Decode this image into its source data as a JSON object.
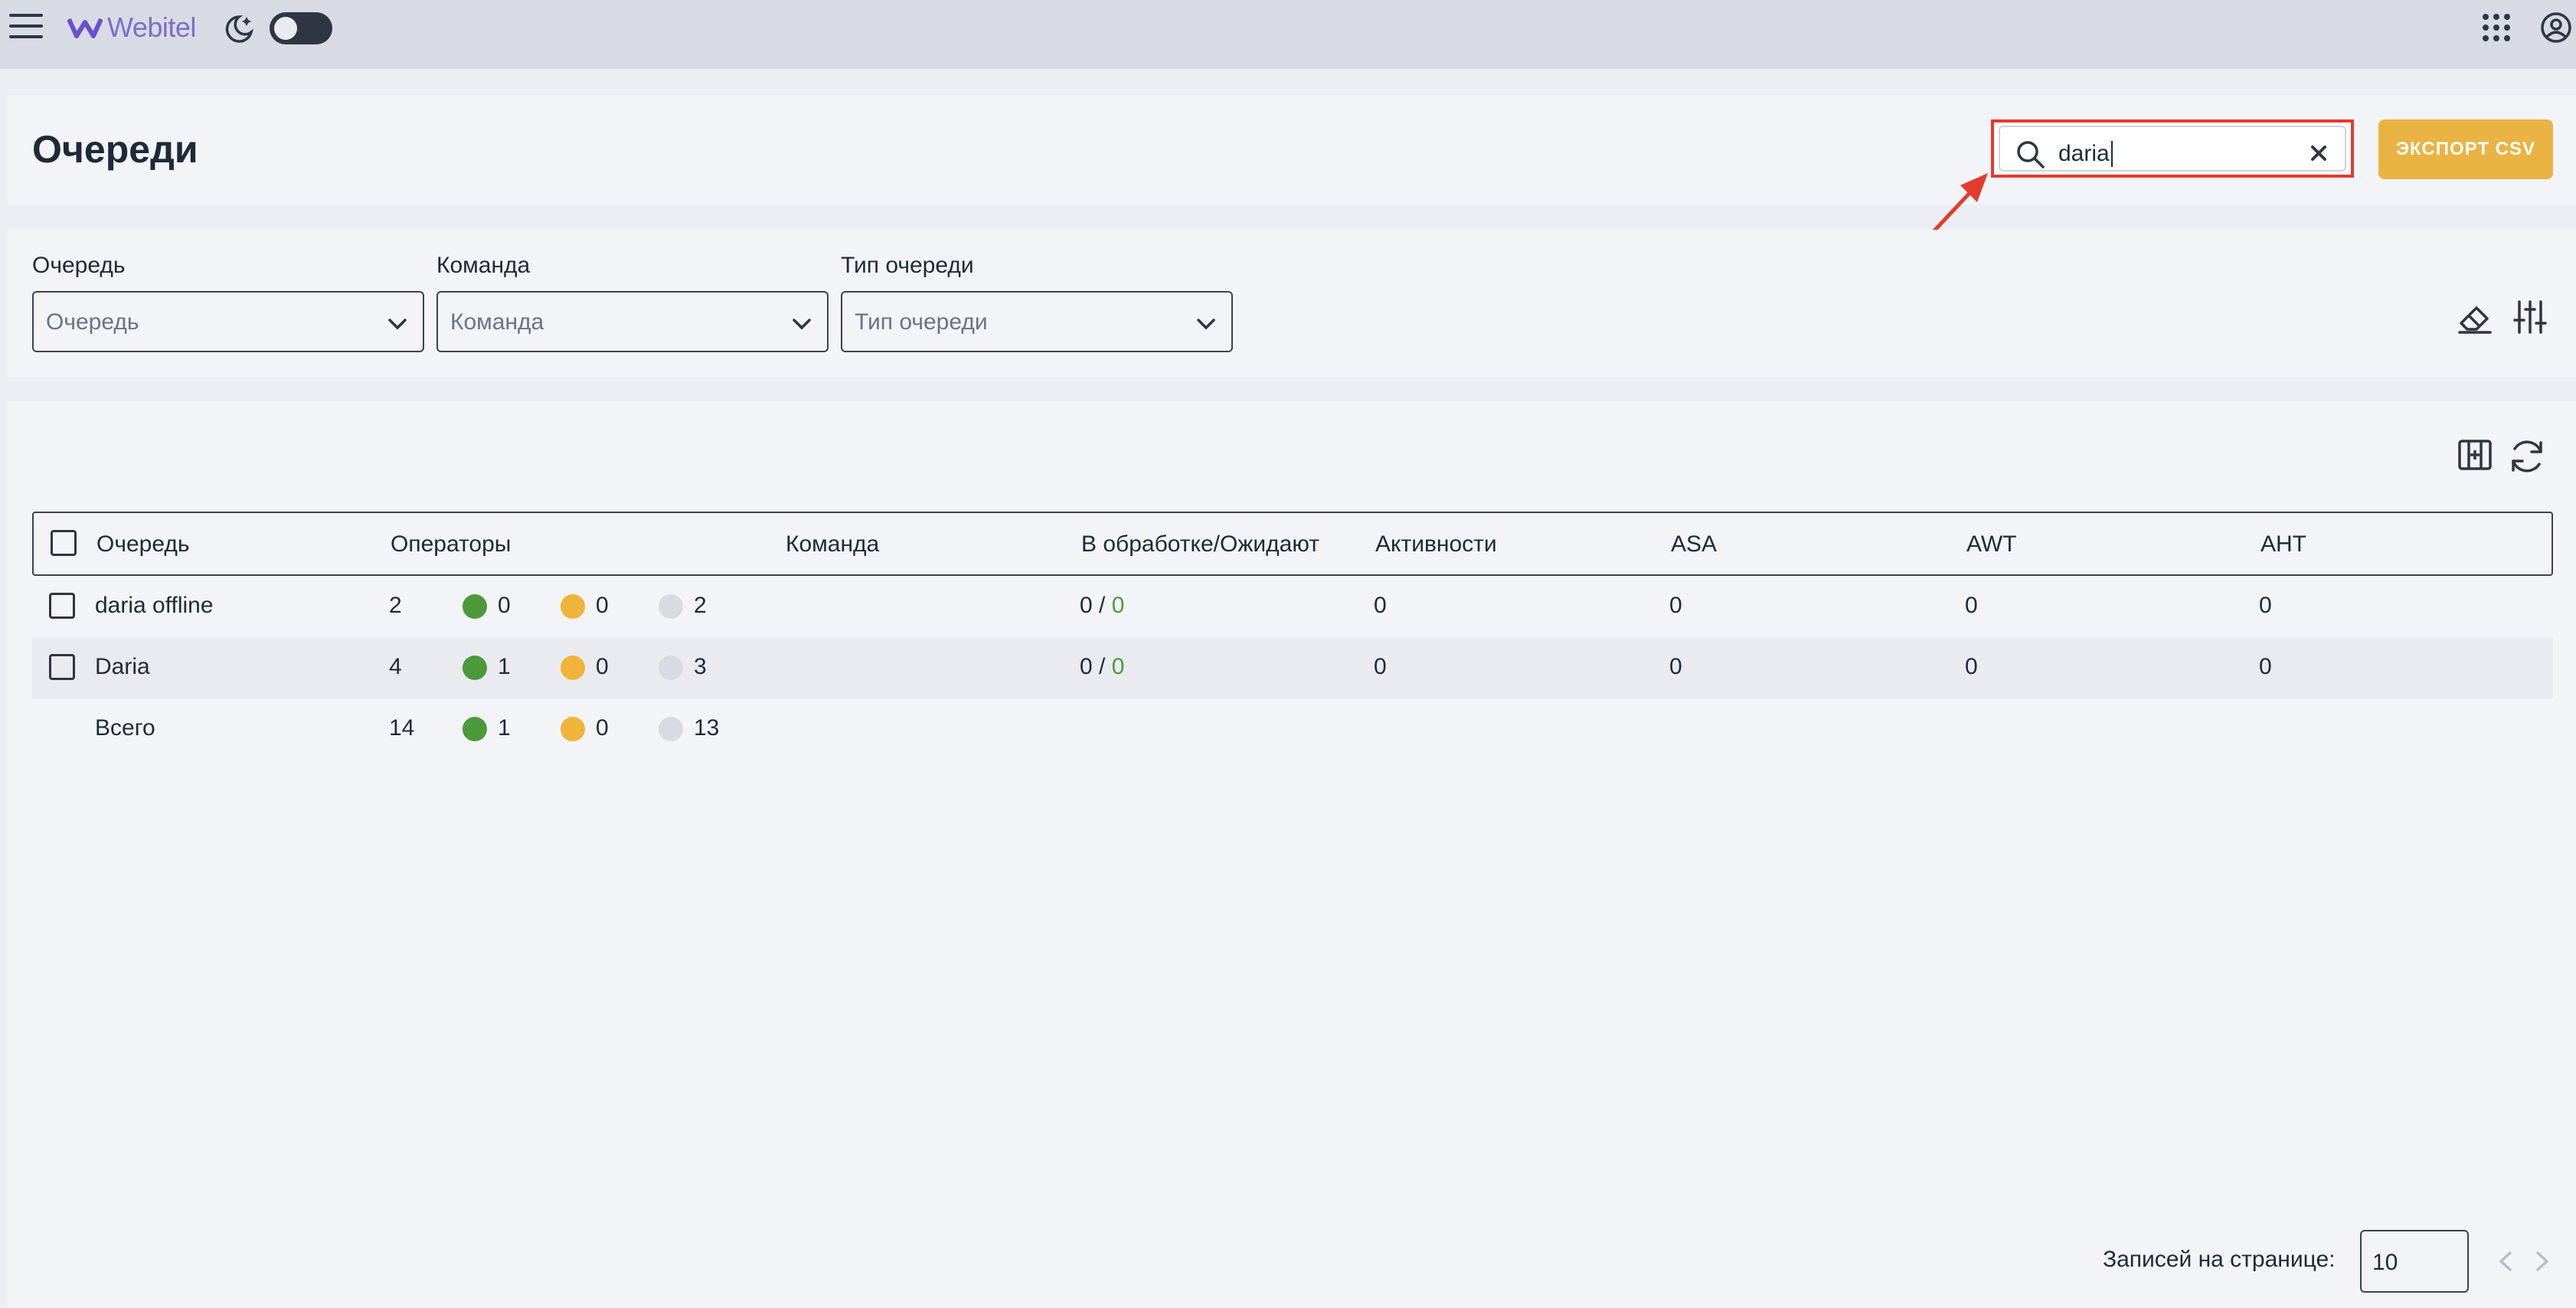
{
  "app": {
    "logo_text": "Webitel"
  },
  "page": {
    "title": "Очереди"
  },
  "search": {
    "value": "daria"
  },
  "export_button": {
    "label": "ЭКСПОРТ CSV"
  },
  "filters": [
    {
      "label": "Очередь",
      "placeholder": "Очередь"
    },
    {
      "label": "Команда",
      "placeholder": "Команда"
    },
    {
      "label": "Тип очереди",
      "placeholder": "Тип очереди"
    }
  ],
  "table": {
    "headers": [
      "Очередь",
      "Операторы",
      "Команда",
      "В обработке/Ожидают",
      "Активности",
      "ASA",
      "AWT",
      "AHT"
    ],
    "rows": [
      {
        "name": "daria offline",
        "operators_total": "2",
        "online": "0",
        "pause": "0",
        "offline": "2",
        "team": "",
        "processing": "0",
        "waiting": "0",
        "activities": "0",
        "asa": "0",
        "awt": "0",
        "aht": "0"
      },
      {
        "name": "Daria",
        "operators_total": "4",
        "online": "1",
        "pause": "0",
        "offline": "3",
        "team": "",
        "processing": "0",
        "waiting": "0",
        "activities": "0",
        "asa": "0",
        "awt": "0",
        "aht": "0"
      }
    ],
    "total": {
      "label": "Всего",
      "operators_total": "14",
      "online": "1",
      "pause": "0",
      "offline": "13"
    }
  },
  "pagination": {
    "label": "Записей на странице:",
    "per_page": "10"
  },
  "colors": {
    "accent": "#e9b444",
    "highlight": "#e23c2d",
    "online": "#4c9a3a",
    "pause": "#f0b43a",
    "offline": "#d9dbe2"
  }
}
